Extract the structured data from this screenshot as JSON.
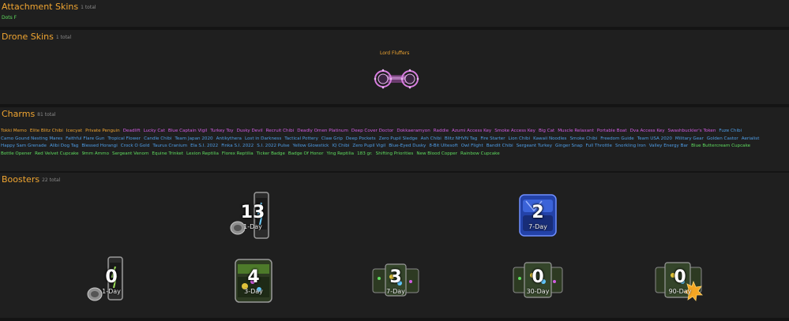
{
  "attachment_skins": {
    "title": "Attachment Skins",
    "count": "1 total",
    "items": [
      "Dots F"
    ]
  },
  "drone_skins": {
    "title": "Drone Skins",
    "count": "1 total",
    "items": [
      "Lord Fluffers"
    ]
  },
  "charms": {
    "title": "Charms",
    "count": "81 total",
    "items": [
      {
        "name": "Tokki Memo",
        "color": "#f0a531"
      },
      {
        "name": "Elite Blitz Chibi",
        "color": "#f0a531"
      },
      {
        "name": "Icecyat",
        "color": "#f0a531"
      },
      {
        "name": "Private Penguin",
        "color": "#f0a531"
      },
      {
        "name": "Deadlift",
        "color": "#d35de3"
      },
      {
        "name": "Lucky Cat",
        "color": "#d35de3"
      },
      {
        "name": "Blue Captain Vigil",
        "color": "#d35de3"
      },
      {
        "name": "Turkey Toy",
        "color": "#d35de3"
      },
      {
        "name": "Dusky Devil",
        "color": "#d35de3"
      },
      {
        "name": "Recruit Chibi",
        "color": "#d35de3"
      },
      {
        "name": "Deadly Omen Platinum",
        "color": "#d35de3"
      },
      {
        "name": "Deep Cover Doctor",
        "color": "#d35de3"
      },
      {
        "name": "Dokkaeramyon",
        "color": "#d35de3"
      },
      {
        "name": "Raddie",
        "color": "#d35de3"
      },
      {
        "name": "Azumi Access Key",
        "color": "#d35de3"
      },
      {
        "name": "Smoke Access Key",
        "color": "#d35de3"
      },
      {
        "name": "Big Cat",
        "color": "#d35de3"
      },
      {
        "name": "Muscle Relaxant",
        "color": "#d35de3"
      },
      {
        "name": "Portable Boat",
        "color": "#d35de3"
      },
      {
        "name": "Dva Access Key",
        "color": "#d35de3"
      },
      {
        "name": "Swashbuckler's Token",
        "color": "#d35de3"
      },
      {
        "name": "Fuze Chibi",
        "color": "#4f9ee8"
      },
      {
        "name": "Camo Gound Nesting Mares",
        "color": "#4f9ee8"
      },
      {
        "name": "Faithful Flare Gun",
        "color": "#4f9ee8"
      },
      {
        "name": "Tropical Flower",
        "color": "#4f9ee8"
      },
      {
        "name": "Candle Chibi",
        "color": "#4f9ee8"
      },
      {
        "name": "Team Japan 2020",
        "color": "#4f9ee8"
      },
      {
        "name": "Antikythera",
        "color": "#4f9ee8"
      },
      {
        "name": "Lost in Darkness",
        "color": "#4f9ee8"
      },
      {
        "name": "Tactical Pottery",
        "color": "#4f9ee8"
      },
      {
        "name": "Claw Grip",
        "color": "#4f9ee8"
      },
      {
        "name": "Deep Pockets",
        "color": "#4f9ee8"
      },
      {
        "name": "Zero Pupil Sledge",
        "color": "#4f9ee8"
      },
      {
        "name": "Ash Chibi",
        "color": "#4f9ee8"
      },
      {
        "name": "Blitz NHVN Tag",
        "color": "#4f9ee8"
      },
      {
        "name": "Fire Starter",
        "color": "#4f9ee8"
      },
      {
        "name": "Lion Chibi",
        "color": "#4f9ee8"
      },
      {
        "name": "Kawaii Noodles",
        "color": "#4f9ee8"
      },
      {
        "name": "Smoke Chibi",
        "color": "#4f9ee8"
      },
      {
        "name": "Freedom Guide",
        "color": "#4f9ee8"
      },
      {
        "name": "Team USA 2020",
        "color": "#4f9ee8"
      },
      {
        "name": "Military Gear",
        "color": "#4f9ee8"
      },
      {
        "name": "Golden Castor",
        "color": "#4f9ee8"
      },
      {
        "name": "Aerialist",
        "color": "#4f9ee8"
      },
      {
        "name": "Happy Sam Grenade",
        "color": "#4f9ee8"
      },
      {
        "name": "Alibi Dog Tag",
        "color": "#4f9ee8"
      },
      {
        "name": "Blessed Horangi",
        "color": "#4f9ee8"
      },
      {
        "name": "Crock O Gold",
        "color": "#4f9ee8"
      },
      {
        "name": "Taurus Cranium",
        "color": "#4f9ee8"
      },
      {
        "name": "Ela S.I. 2022",
        "color": "#4f9ee8"
      },
      {
        "name": "Finka S.I. 2022",
        "color": "#4f9ee8"
      },
      {
        "name": "S.I. 2022 Pulse",
        "color": "#4f9ee8"
      },
      {
        "name": "Yellow Glowstick",
        "color": "#4f9ee8"
      },
      {
        "name": "IQ Chibi",
        "color": "#4f9ee8"
      },
      {
        "name": "Zero Pupil Vigil",
        "color": "#4f9ee8"
      },
      {
        "name": "Blue-Eyed Dusky",
        "color": "#4f9ee8"
      },
      {
        "name": "8-Bit Ultesoft",
        "color": "#4f9ee8"
      },
      {
        "name": "Owl Flight",
        "color": "#4f9ee8"
      },
      {
        "name": "Bandit Chibi",
        "color": "#4f9ee8"
      },
      {
        "name": "Sergeant Turkey",
        "color": "#4f9ee8"
      },
      {
        "name": "Ginger Snap",
        "color": "#4f9ee8"
      },
      {
        "name": "Full Throttle",
        "color": "#4f9ee8"
      },
      {
        "name": "Snorkling Iron",
        "color": "#4f9ee8"
      },
      {
        "name": "Valley Energy Bar",
        "color": "#4f9ee8"
      },
      {
        "name": "Blue Buttercream Cupcake",
        "color": "#5fdd5f"
      },
      {
        "name": "Bottle Opener",
        "color": "#5fdd5f"
      },
      {
        "name": "Red Velvet Cupcake",
        "color": "#5fdd5f"
      },
      {
        "name": "9mm Ammo",
        "color": "#5fdd5f"
      },
      {
        "name": "Sergeant Venom",
        "color": "#5fdd5f"
      },
      {
        "name": "Equine Trinket",
        "color": "#5fdd5f"
      },
      {
        "name": "Lexion Reptilia",
        "color": "#5fdd5f"
      },
      {
        "name": "Florex Reptilia",
        "color": "#5fdd5f"
      },
      {
        "name": "Ticker Badge",
        "color": "#5fdd5f"
      },
      {
        "name": "Badge Of Honor",
        "color": "#5fdd5f"
      },
      {
        "name": "Ying Reptilia",
        "color": "#5fdd5f"
      },
      {
        "name": "183 gr.",
        "color": "#5fdd5f"
      },
      {
        "name": "Shifting Priorities",
        "color": "#5fdd5f"
      },
      {
        "name": "New Blood Copper",
        "color": "#5fdd5f"
      },
      {
        "name": "Rainbow Cupcake",
        "color": "#5fdd5f"
      }
    ]
  },
  "boosters": {
    "title": "Boosters",
    "count": "22 total",
    "items": [
      {
        "count": "13",
        "label": "1-Day",
        "icon": "energy-can-icon"
      },
      {
        "count": "2",
        "label": "7-Day",
        "icon": "booster-box-icon"
      },
      {
        "count": "0",
        "label": "1-Day",
        "icon": "energy-can-icon"
      },
      {
        "count": "4",
        "label": "3-Day",
        "icon": "booster-pack-icon"
      },
      {
        "count": "3",
        "label": "7-Day",
        "icon": "booster-pack-icon"
      },
      {
        "count": "0",
        "label": "30-Day",
        "icon": "booster-pack-icon"
      },
      {
        "count": "0",
        "label": "90-Day",
        "icon": "booster-pack-gold-icon"
      }
    ]
  },
  "colors": {
    "title": "#f0a531",
    "legendary": "#f0a531",
    "epic": "#d35de3",
    "rare": "#4f9ee8",
    "uncommon": "#5fdd5f",
    "panel": "#1f1f1f",
    "background": "#141414"
  }
}
